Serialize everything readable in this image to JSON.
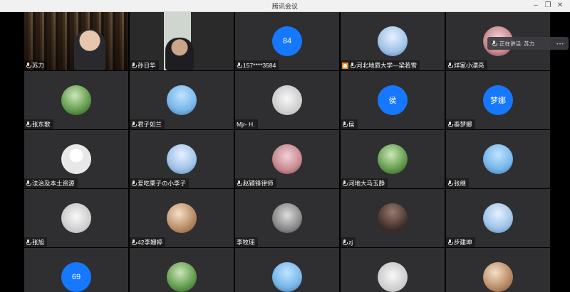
{
  "window": {
    "title": "腾讯会议"
  },
  "speaking": {
    "label": "正在讲话: 苏力"
  },
  "colors": {
    "tile_bg": "#2f2f31",
    "blue_avatar": "#1677ff",
    "host_tag": "#f08a24"
  },
  "participants": [
    {
      "name": "苏力",
      "avatar_type": "video-bookshelf"
    },
    {
      "name": "孙日华",
      "avatar_type": "video-book"
    },
    {
      "name": "157****3584",
      "avatar_text": "84",
      "avatar_type": "blue"
    },
    {
      "name": "河北地质大学—梁若雪",
      "avatar_type": "photo",
      "host": true
    },
    {
      "name": "烊家小漂亮",
      "avatar_type": "photo"
    },
    {
      "name": "张东歌",
      "avatar_type": "photo"
    },
    {
      "name": "君子如兰",
      "avatar_type": "photo"
    },
    {
      "name": "Mjr- H.",
      "avatar_type": "photo",
      "no_mic": true
    },
    {
      "name": "侯",
      "avatar_text": "侯",
      "avatar_type": "blue"
    },
    {
      "name": "秦梦娜",
      "avatar_text": "梦娜",
      "avatar_type": "blue"
    },
    {
      "name": "法治及本土资源",
      "avatar_type": "default"
    },
    {
      "name": "爱吃栗子の小李子",
      "avatar_type": "photo"
    },
    {
      "name": "赵颖锋律师",
      "avatar_type": "photo"
    },
    {
      "name": "河地大马玉静",
      "avatar_type": "photo"
    },
    {
      "name": "张继",
      "avatar_type": "photo"
    },
    {
      "name": "张旭",
      "avatar_type": "photo"
    },
    {
      "name": "42李姗婷",
      "avatar_type": "photo"
    },
    {
      "name": "李牧瑶",
      "avatar_type": "photo",
      "no_mic": true
    },
    {
      "name": "zj",
      "avatar_type": "photo"
    },
    {
      "name": "步建坤",
      "avatar_type": "photo"
    },
    {
      "name": "",
      "avatar_text": "69",
      "avatar_type": "blue"
    },
    {
      "name": "",
      "avatar_type": "photo"
    },
    {
      "name": "",
      "avatar_type": "photo"
    },
    {
      "name": "",
      "avatar_type": "photo"
    },
    {
      "name": "",
      "avatar_type": "photo"
    }
  ]
}
